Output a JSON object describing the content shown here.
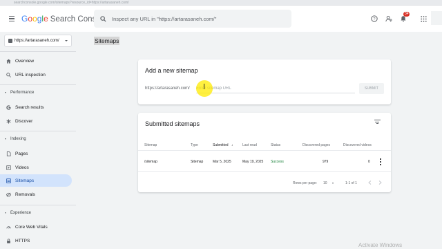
{
  "browser": {
    "url_fragment": "searchconsole.google.com/sitemaps?resource_id=https://artarasaneh.com/"
  },
  "app": {
    "logo_google": "Google",
    "logo_product": "Search Console"
  },
  "search": {
    "placeholder": "Inspect any URL in \"https://artarasaneh.com/\""
  },
  "topbar": {
    "notification_count": "34"
  },
  "property": {
    "name": "https://artarasaneh.com/"
  },
  "sidebar": {
    "overview": "Overview",
    "url_inspection": "URL inspection",
    "performance": {
      "label": "Performance",
      "items": [
        "Search results",
        "Discover"
      ]
    },
    "indexing": {
      "label": "Indexing",
      "items": [
        "Pages",
        "Videos",
        "Sitemaps",
        "Removals"
      ]
    },
    "experience": {
      "label": "Experience",
      "items": [
        "Core Web Vitals",
        "HTTPS"
      ]
    }
  },
  "page": {
    "title": "Sitemaps"
  },
  "add_sitemap": {
    "title": "Add a new sitemap",
    "prefix": "https://artarasaneh.com/",
    "input_placeholder": "Enter sitemap URL",
    "submit_label": "SUBMIT"
  },
  "submitted": {
    "title": "Submitted sitemaps",
    "columns": [
      "Sitemap",
      "Type",
      "Submitted",
      "Last read",
      "Status",
      "Discovered pages",
      "Discovered videos"
    ],
    "rows": [
      [
        "/sitemap",
        "Sitemap",
        "Mar 5, 2025",
        "May 19, 2025",
        "Success",
        "979",
        "0"
      ]
    ],
    "pagination": {
      "rows_label": "Rows per page:",
      "rows_value": "10",
      "range": "1-1 of 1"
    }
  },
  "colors": {
    "accent": "#1a73e8",
    "success": "#188038",
    "active_nav_bg": "#d2e3fc",
    "badge": "#d93025"
  },
  "watermark": "Activate Windows"
}
